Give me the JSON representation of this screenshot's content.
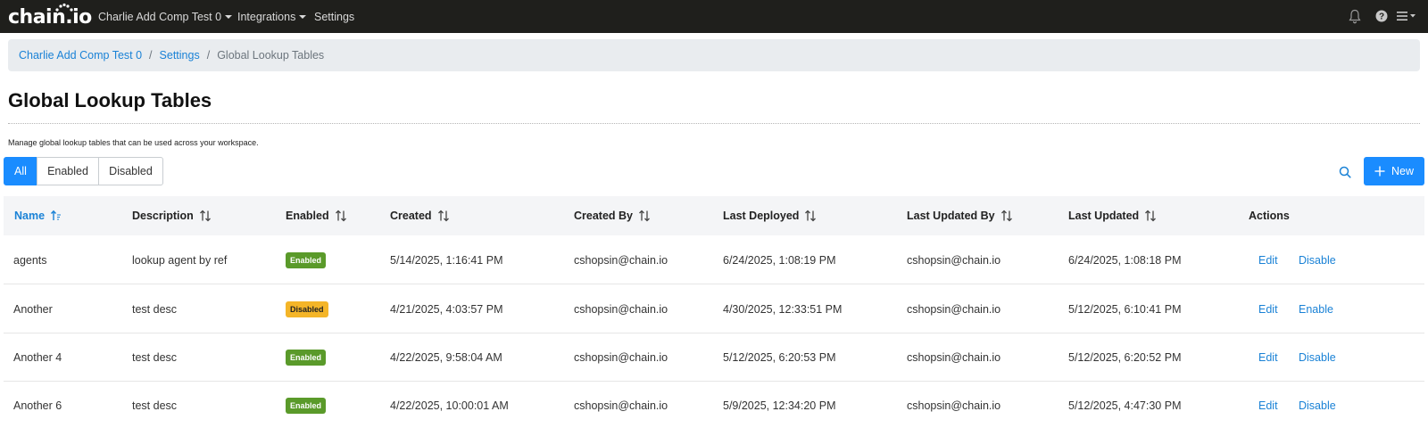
{
  "navbar": {
    "logo": "chain.io",
    "workspace": "Charlie Add Comp Test 0",
    "integrations": "Integrations",
    "settings": "Settings",
    "icons": [
      "bell-icon",
      "help-icon",
      "menu-icon"
    ]
  },
  "breadcrumb": {
    "items": [
      "Charlie Add Comp Test 0",
      "Settings"
    ],
    "current": "Global Lookup Tables",
    "separator": "/"
  },
  "page": {
    "title": "Global Lookup Tables",
    "subtitle": "Manage global lookup tables that can be used across your workspace."
  },
  "filters": {
    "all": "All",
    "enabled": "Enabled",
    "disabled": "Disabled",
    "selected": "All"
  },
  "toolbar": {
    "new_label": "New"
  },
  "table": {
    "columns": [
      "Name",
      "Description",
      "Enabled",
      "Created",
      "Created By",
      "Last Deployed",
      "Last Updated By",
      "Last Updated",
      "Actions"
    ],
    "sorted_column": "Name",
    "rows": [
      {
        "name": "agents",
        "description": "lookup agent by ref",
        "status": "Enabled",
        "created": "5/14/2025, 1:16:41 PM",
        "created_by": "cshopsin@chain.io",
        "last_deployed": "6/24/2025, 1:08:19 PM",
        "last_updated_by": "cshopsin@chain.io",
        "last_updated": "6/24/2025, 1:08:18 PM",
        "edit": "Edit",
        "toggle": "Disable"
      },
      {
        "name": "Another",
        "description": "test desc",
        "status": "Disabled",
        "created": "4/21/2025, 4:03:57 PM",
        "created_by": "cshopsin@chain.io",
        "last_deployed": "4/30/2025, 12:33:51 PM",
        "last_updated_by": "cshopsin@chain.io",
        "last_updated": "5/12/2025, 6:10:41 PM",
        "edit": "Edit",
        "toggle": "Enable"
      },
      {
        "name": "Another 4",
        "description": "test desc",
        "status": "Enabled",
        "created": "4/22/2025, 9:58:04 AM",
        "created_by": "cshopsin@chain.io",
        "last_deployed": "5/12/2025, 6:20:53 PM",
        "last_updated_by": "cshopsin@chain.io",
        "last_updated": "5/12/2025, 6:20:52 PM",
        "edit": "Edit",
        "toggle": "Disable"
      },
      {
        "name": "Another 6",
        "description": "test desc",
        "status": "Enabled",
        "created": "4/22/2025, 10:00:01 AM",
        "created_by": "cshopsin@chain.io",
        "last_deployed": "5/9/2025, 12:34:20 PM",
        "last_updated_by": "cshopsin@chain.io",
        "last_updated": "5/12/2025, 4:47:30 PM",
        "edit": "Edit",
        "toggle": "Disable"
      }
    ]
  },
  "colors": {
    "navbar": "#1f1f1c",
    "accent": "#1a8cff",
    "link": "#1a82d6",
    "enabled_badge": "#5a9a2a",
    "disabled_badge": "#f4b528"
  }
}
